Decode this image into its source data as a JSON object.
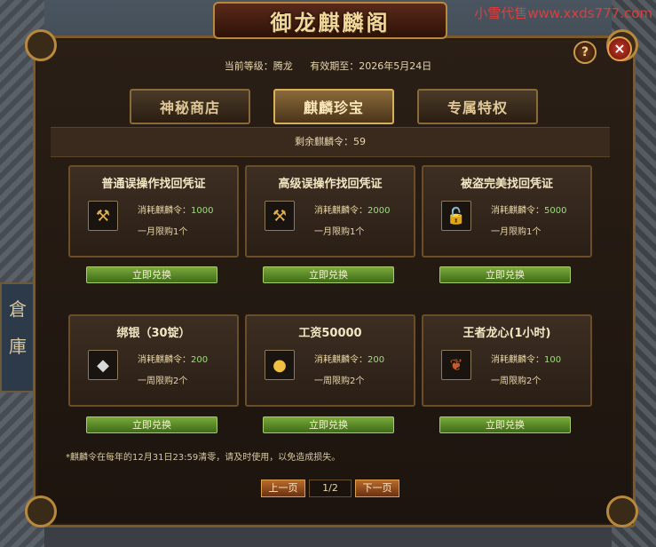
{
  "watermark": "小雪代售www.xxds777.com",
  "window": {
    "title": "御龙麒麟阁",
    "help_label": "?",
    "close_label": "×"
  },
  "status": {
    "level_label": "当前等级：",
    "level_value": "腾龙",
    "expire_label": "有效期至：",
    "expire_value": "2026年5月24日"
  },
  "tabs": [
    {
      "label": "神秘商店",
      "active": false
    },
    {
      "label": "麒麟珍宝",
      "active": true
    },
    {
      "label": "专属特权",
      "active": false
    }
  ],
  "remain": {
    "label": "剩余麒麟令：",
    "value": "59"
  },
  "items": [
    {
      "title": "普通误操作找回凭证",
      "icon": "wrench-icon",
      "cost_label": "消耗麒麟令：",
      "cost": "1000",
      "limit": "一月限购1个",
      "button": "立即兑换"
    },
    {
      "title": "高级误操作找回凭证",
      "icon": "wrench-icon",
      "cost_label": "消耗麒麟令：",
      "cost": "2000",
      "limit": "一月限购1个",
      "button": "立即兑换"
    },
    {
      "title": "被盗完美找回凭证",
      "icon": "unlock-icon",
      "cost_label": "消耗麒麟令：",
      "cost": "5000",
      "limit": "一月限购1个",
      "button": "立即兑换"
    },
    {
      "title": "绑银（30锭）",
      "icon": "silver-ingot-icon",
      "cost_label": "消耗麒麟令：",
      "cost": "200",
      "limit": "一周限购2个",
      "button": "立即兑换"
    },
    {
      "title": "工资50000",
      "icon": "gold-coins-icon",
      "cost_label": "消耗麒麟令：",
      "cost": "200",
      "limit": "一周限购2个",
      "button": "立即兑换"
    },
    {
      "title": "王者龙心(1小时)",
      "icon": "dragon-heart-icon",
      "cost_label": "消耗麒麟令：",
      "cost": "100",
      "limit": "一周限购2个",
      "button": "立即兑换"
    }
  ],
  "notice": "*麒麟令在每年的12月31日23:59清零，请及时使用，以免造成损失。",
  "pager": {
    "prev": "上一页",
    "page": "1/2",
    "next": "下一页"
  },
  "background": {
    "sign_text_1": "倉",
    "sign_text_2": "庫"
  }
}
